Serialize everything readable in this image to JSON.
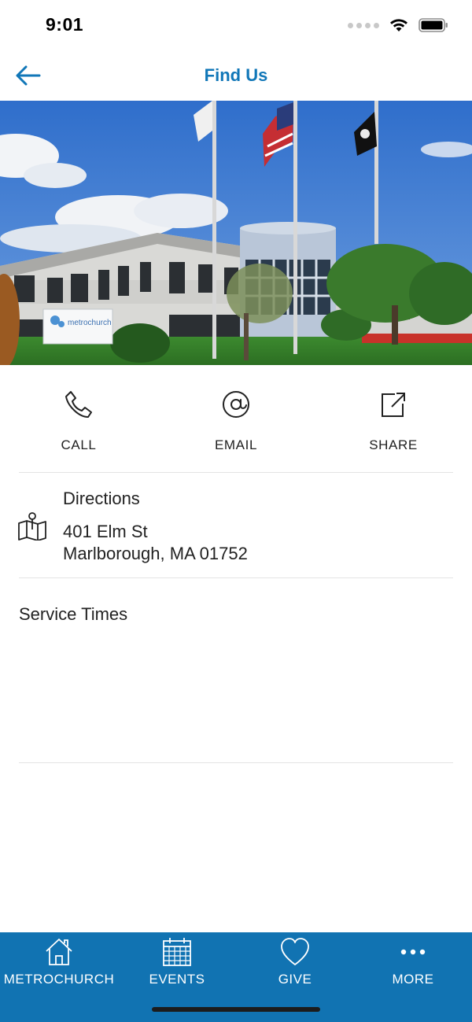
{
  "status_bar": {
    "time": "9:01"
  },
  "header": {
    "title": "Find Us"
  },
  "hero": {
    "sign_text": "metrochurch"
  },
  "actions": [
    {
      "label": "CALL",
      "icon": "phone-icon"
    },
    {
      "label": "EMAIL",
      "icon": "at-icon"
    },
    {
      "label": "SHARE",
      "icon": "share-icon"
    }
  ],
  "directions": {
    "title": "Directions",
    "address_line1": "401 Elm St",
    "address_line2": "Marlborough, MA 01752",
    "icon": "map-icon"
  },
  "service_times": {
    "title": "Service Times"
  },
  "tab_bar": {
    "background": "#1173b2",
    "tabs": [
      {
        "label": "METROCHURCH",
        "icon": "home-icon"
      },
      {
        "label": "EVENTS",
        "icon": "calendar-icon"
      },
      {
        "label": "GIVE",
        "icon": "heart-icon"
      },
      {
        "label": "MORE",
        "icon": "more-icon"
      }
    ]
  },
  "colors": {
    "accent": "#1177b8",
    "tab_bar": "#1173b2",
    "divider": "#e3e3e3"
  }
}
